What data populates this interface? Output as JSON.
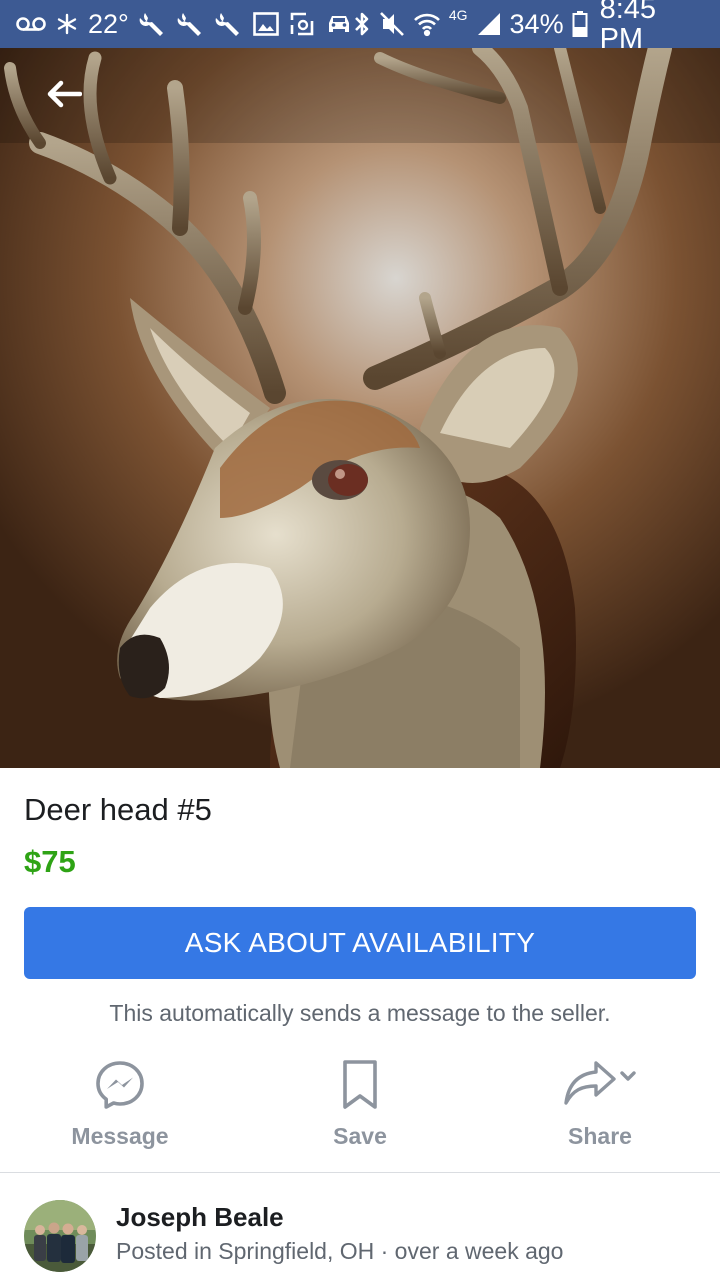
{
  "status_bar": {
    "temperature": "22°",
    "network": "4G",
    "battery": "34%",
    "time": "8:45 PM",
    "icons": [
      "voicemail-icon",
      "snowflake-icon",
      "wrench-icon",
      "wrench-icon",
      "wrench-icon",
      "image-icon",
      "screenshot-icon",
      "car-icon",
      "bluetooth-icon",
      "mute-icon",
      "wifi-icon",
      "signal-icon",
      "battery-icon"
    ]
  },
  "header": {
    "back_icon": "arrow-left-icon"
  },
  "hero": {
    "image": "deer-head-photo"
  },
  "listing": {
    "title": "Deer head #5",
    "price": "$75"
  },
  "cta": {
    "label": "ASK ABOUT AVAILABILITY",
    "note": "This automatically sends a message to the seller."
  },
  "actions": [
    {
      "label": "Message",
      "icon": "messenger-icon"
    },
    {
      "label": "Save",
      "icon": "bookmark-icon"
    },
    {
      "label": "Share",
      "icon": "share-icon"
    }
  ],
  "seller": {
    "name": "Joseph Beale",
    "meta": "Posted in Springfield, OH · over a week ago"
  },
  "colors": {
    "status_bar": "#3d5a93",
    "primary_button": "#3578e5",
    "price": "#2ea315",
    "muted_text": "#606770",
    "icon_gray": "#8d949e"
  }
}
